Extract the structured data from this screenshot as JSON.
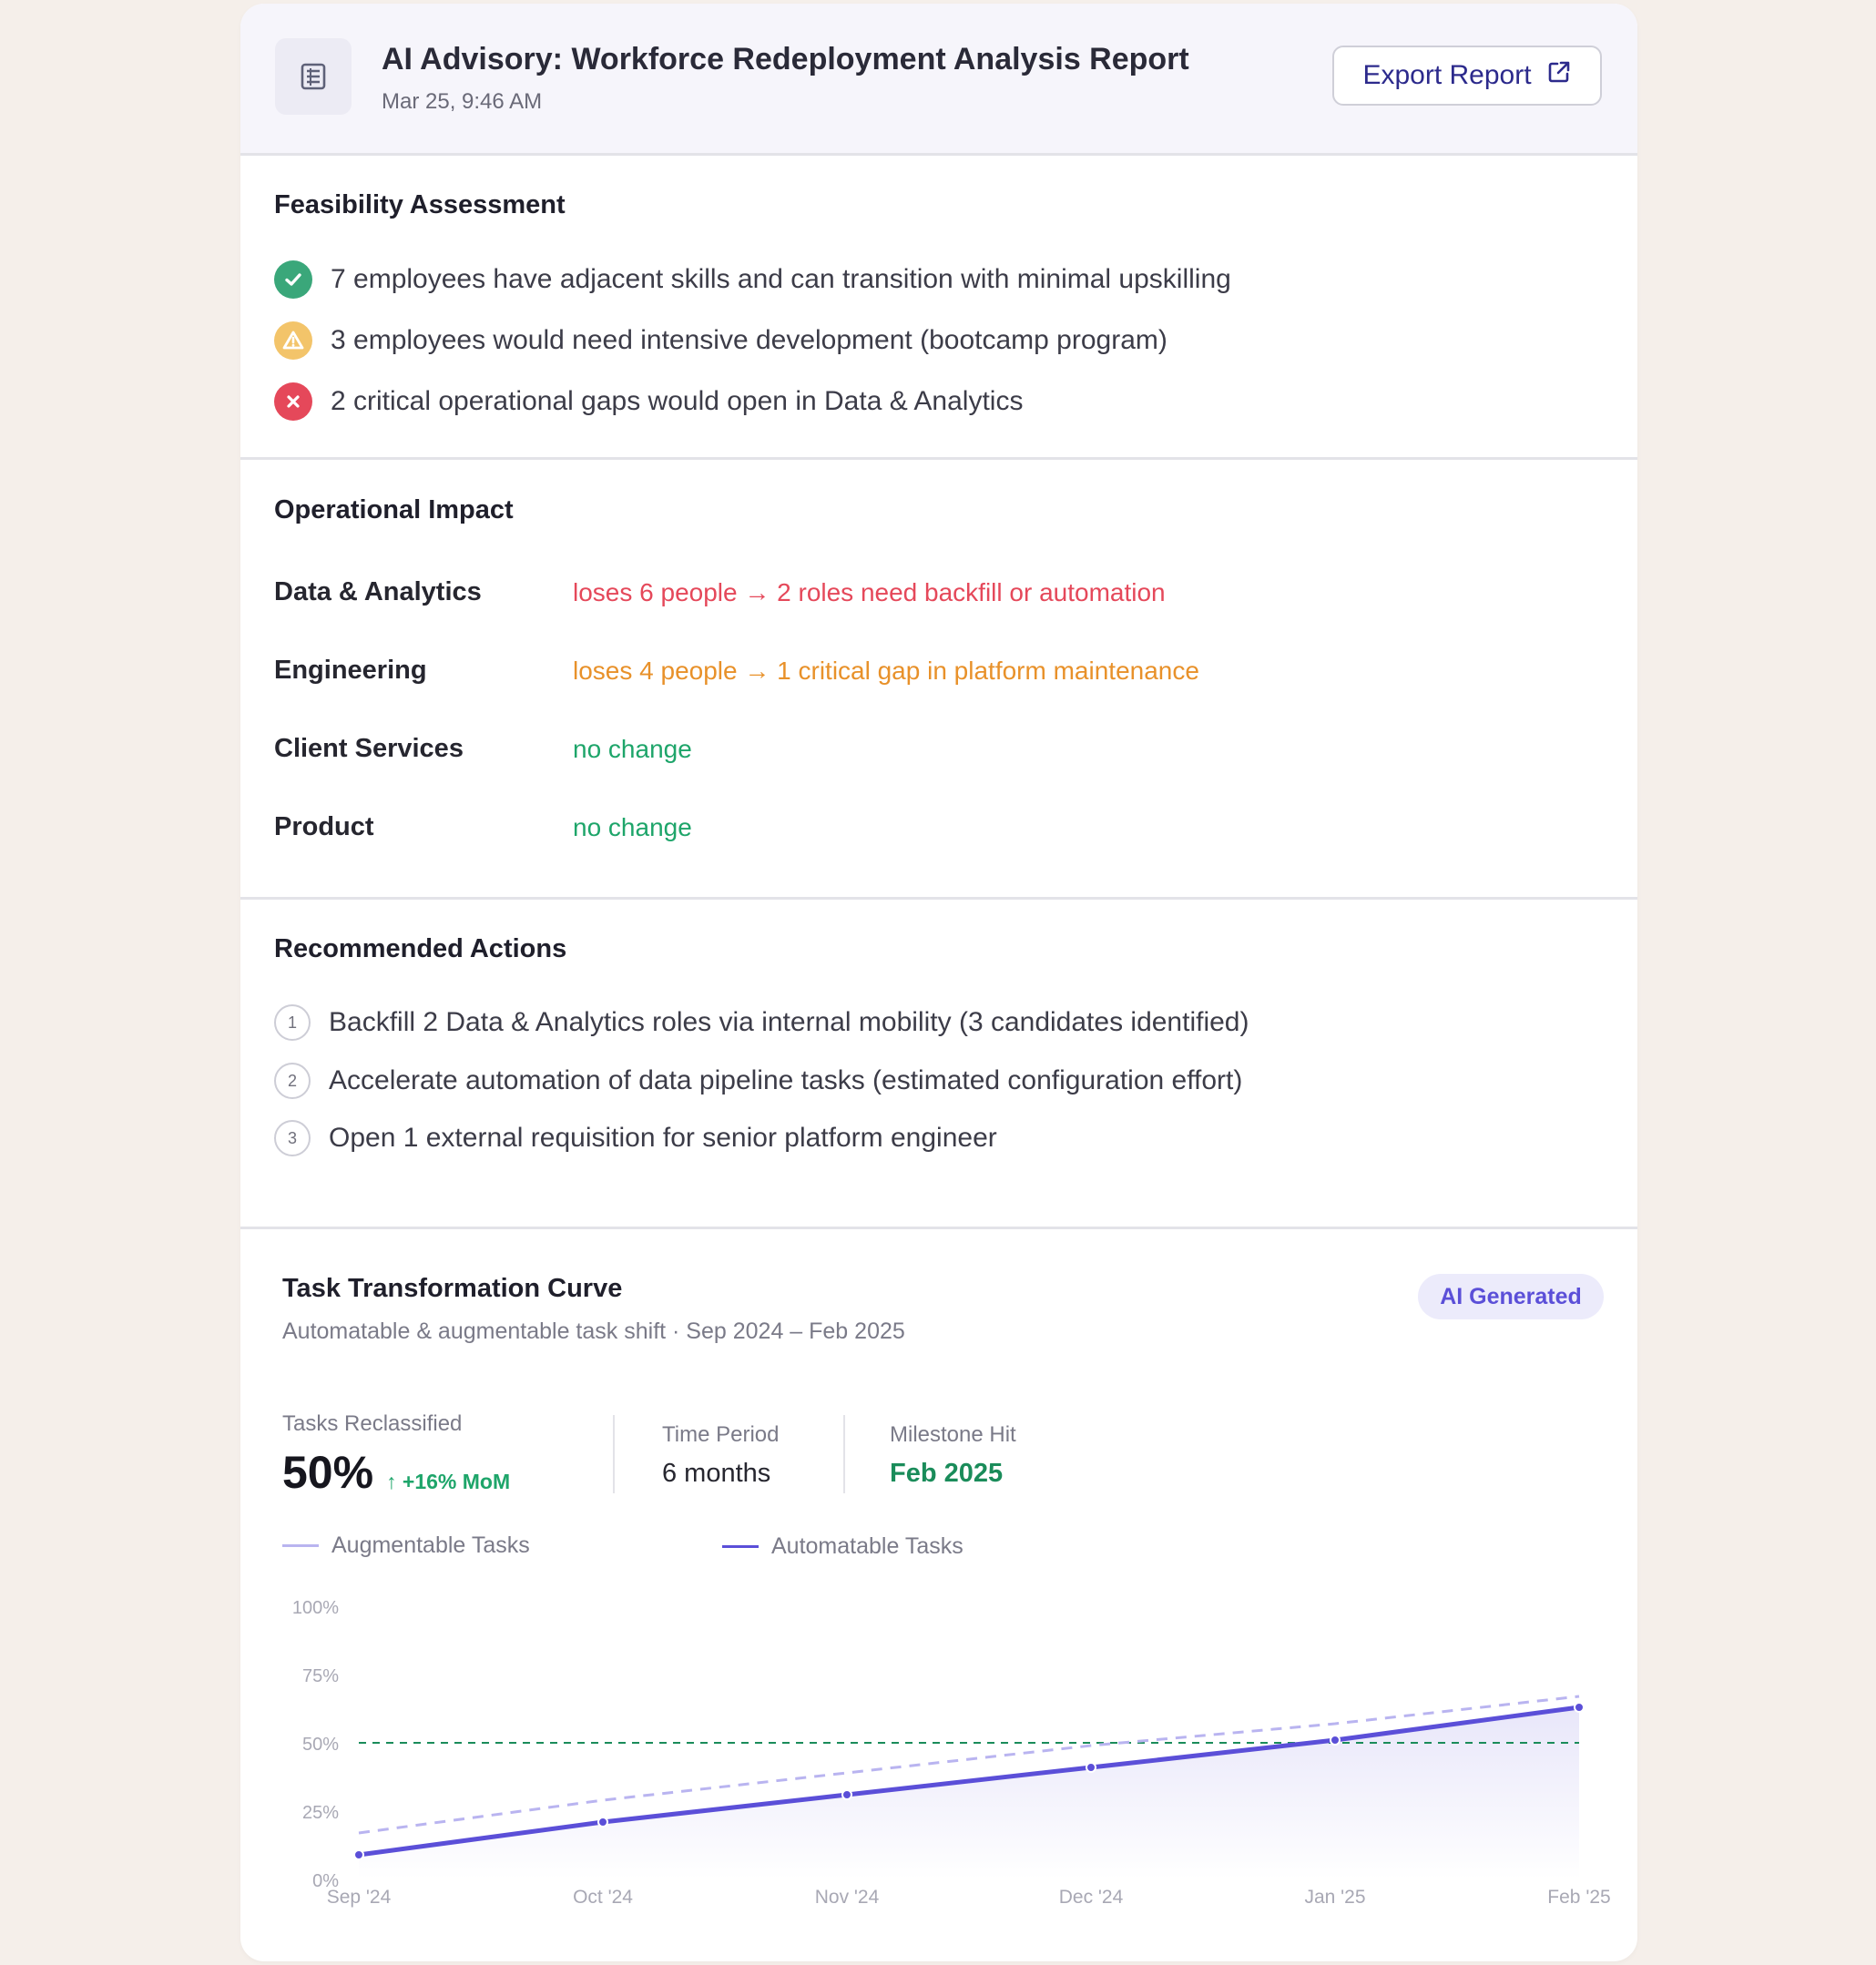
{
  "header": {
    "title": "AI Advisory: Workforce Redeployment Analysis Report",
    "date": "Mar 25, 9:46 AM",
    "export_label": "Export Report"
  },
  "feasibility": {
    "title": "Feasibility Assessment",
    "items": [
      {
        "status": "success",
        "text": "7 employees have adjacent skills and can transition with minimal upskilling"
      },
      {
        "status": "warning",
        "text": "3 employees would need intensive development (bootcamp program)"
      },
      {
        "status": "error",
        "text": "2 critical operational gaps would open in Data & Analytics"
      }
    ]
  },
  "impact": {
    "title": "Operational Impact",
    "rows": [
      {
        "department": "Data & Analytics",
        "value": "loses 6 people → 2 roles need backfill or automation",
        "color": "#e5485a"
      },
      {
        "department": "Engineering",
        "value": "loses 4 people → 1 critical gap in platform maintenance",
        "color": "#e8912a"
      },
      {
        "department": "Client Services",
        "value": "no change",
        "color": "#1ea56a"
      },
      {
        "department": "Product",
        "value": "no change",
        "color": "#1ea56a"
      }
    ]
  },
  "actions": {
    "title": "Recommended Actions",
    "items": [
      {
        "number": "1",
        "text": "Backfill 2 Data & Analytics roles via internal mobility (3 candidates identified)"
      },
      {
        "number": "2",
        "text": "Accelerate automation of data pipeline tasks (estimated configuration effort)"
      },
      {
        "number": "3",
        "text": "Open 1 external requisition for senior platform engineer"
      }
    ]
  },
  "curve": {
    "title": "Task Transformation Curve",
    "subtitle": "Automatable & augmentable task shift · Sep 2024 – Feb 2025",
    "badge": "AI Generated",
    "stats": {
      "reclassified_label": "Tasks Reclassified",
      "reclassified_value": "50%",
      "reclassified_delta": "↑ +16% MoM",
      "period_label": "Time Period",
      "period_value": "6 months",
      "milestone_label": "Milestone Hit",
      "milestone_value": "Feb 2025"
    }
  },
  "colors": {
    "accent": "#5b4fd8",
    "augmentable": "#b9b4f0",
    "automatable": "#5b4fd8",
    "milestone": "#1a8c5a",
    "success": "#3aa77a",
    "warning": "#f3c46a",
    "error": "#e5485a"
  },
  "chart_data": {
    "type": "line",
    "categories": [
      "Sep '24",
      "Oct '24",
      "Nov '24",
      "Dec '24",
      "Jan '25",
      "Feb '25"
    ],
    "series": [
      {
        "name": "Augmentable Tasks",
        "values": [
          17,
          29,
          39,
          49,
          57,
          67
        ],
        "style": "dashed",
        "color": "#b9b4f0"
      },
      {
        "name": "Automatable Tasks",
        "values": [
          9,
          21,
          31,
          41,
          51,
          63
        ],
        "style": "solid",
        "color": "#5b4fd8"
      }
    ],
    "threshold": 50,
    "yticks": [
      "0%",
      "25%",
      "50%",
      "75%",
      "100%"
    ],
    "ylim": [
      0,
      100
    ],
    "legend": "top-left",
    "grid": false
  }
}
